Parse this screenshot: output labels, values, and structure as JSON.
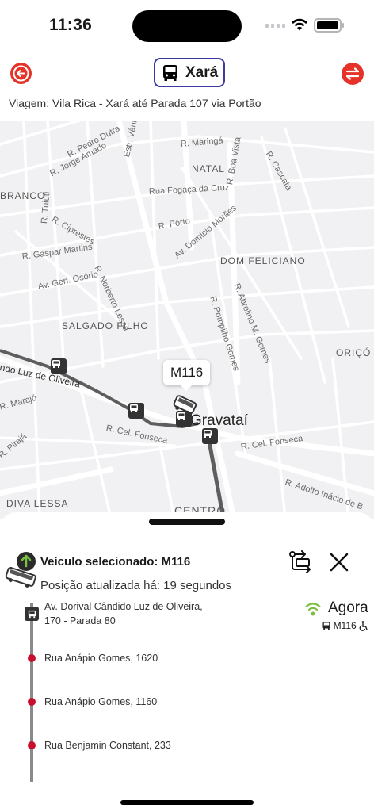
{
  "status_bar": {
    "time": "11:36"
  },
  "header": {
    "line_title": "Xará",
    "trip": "Viagem: Vila Rica - Xará até Parada 107 via Portão"
  },
  "map": {
    "labels": {
      "r_pedro_dutra": "R. Pedro Dutra",
      "r_jorge_amado": "R. Jorge Amado",
      "estr_vania": "Estr. Vânia",
      "r_maringa": "R. Maringá",
      "r_boa_vista": "R. Boa Vista",
      "r_cascata": "R. Cascata",
      "natal": "NATAL",
      "branco": "BRANCO",
      "rua_fogaca": "Rua Fogaça da Cruz",
      "r_tuiuti": "R. Tuiuti",
      "r_ciprestes": "R. Ciprestes",
      "r_porto": "R. Pôrto",
      "av_domicio": "Av. Domício Morães",
      "dom_feliciano": "DOM FELICIANO",
      "r_gaspar": "R. Gaspar Martins",
      "r_norberto": "R. Norberto Lessa",
      "av_gen_osorio": "Av. Gen. Osório",
      "r_abrelino": "R. Abrelino M. Gomes",
      "r_pompilho": "R. Pompilho Gomes",
      "salgado_filho": "SALGADO FILHO",
      "orico": "ORIÇÓ",
      "ndo_luz": "ndo Luz de Oliveira",
      "r_marajo": "R. Marajó",
      "r_cel_fonseca": "R. Cel. Fonseca",
      "r_cel_fonseca_2": "R. Cel. Fonseca",
      "gravatai": "Gravataí",
      "r_piraja": "R. Pirajá",
      "r_adolfo": "R. Adolfo Inácio de B",
      "diva_lessa": "DIVA LESSA",
      "centro": "CENTRO"
    },
    "vehicle_label": "M116"
  },
  "sheet": {
    "selected_title": "Veículo selecionado: M116",
    "updated": "Posição atualizada há: 19 segundos",
    "arrival_now": "Agora",
    "arrival_vehicle": "M116",
    "stops": [
      {
        "name": "Av. Dorival Cândido Luz de Oliveira,",
        "name2": "170 - Parada 80"
      },
      {
        "name": "Rua Anápio Gomes, 1620"
      },
      {
        "name": "Rua Anápio Gomes, 1160"
      },
      {
        "name": "Rua Benjamin Constant, 233"
      }
    ]
  },
  "colors": {
    "accent_red": "#e5332a",
    "chip_border": "#3b3aa0",
    "live_green": "#7ac143",
    "stop_dot": "#c8102e"
  },
  "icons": [
    "back-arrow-icon",
    "bus-icon",
    "swap-direction-icon",
    "bus-stop-icon",
    "vehicle-icon",
    "route-icon",
    "close-icon",
    "live-signal-icon",
    "wheelchair-icon"
  ]
}
